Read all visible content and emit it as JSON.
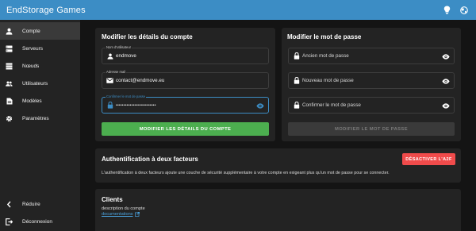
{
  "app": {
    "title": "EndStorage Games"
  },
  "topbar": {
    "icons": [
      "lightbulb-icon",
      "globe-icon"
    ]
  },
  "sidebar": {
    "items": [
      {
        "label": "Compte",
        "icon": "user-icon",
        "active": true
      },
      {
        "label": "Serveurs",
        "icon": "server-icon",
        "active": false
      },
      {
        "label": "Nœuds",
        "icon": "nodes-icon",
        "active": false
      },
      {
        "label": "Utilisateurs",
        "icon": "users-icon",
        "active": false
      },
      {
        "label": "Modèles",
        "icon": "file-icon",
        "active": false
      },
      {
        "label": "Paramètres",
        "icon": "gear-icon",
        "active": false
      }
    ],
    "collapse_label": "Réduire",
    "logout_label": "Déconnexion"
  },
  "account_card": {
    "title": "Modifier les détails du compte",
    "username": {
      "label": "Nom d'utilisateur",
      "value": "endmove"
    },
    "email": {
      "label": "Adresse mail",
      "value": "contact@endmove.eu"
    },
    "password": {
      "label": "Confirmer le mot de passe",
      "value": "••••••••••••••••••••••••••"
    },
    "submit_label": "Modifier les détails du compte"
  },
  "password_card": {
    "title": "Modifier le mot de passe",
    "old_placeholder": "Ancien mot de passe",
    "new_placeholder": "Nouveau mot de passe",
    "confirm_placeholder": "Confirmer le mot de passe",
    "submit_label": "Modifier le mot de passe"
  },
  "twofa_card": {
    "title": "Authentification à deux facteurs",
    "button_label": "Désactiver l'A2F",
    "description": "L'authentification à deux facteurs ajoute une couche de sécurité supplémentaire à votre compte en exigeant plus qu'un mot de passe pour se connecter."
  },
  "clients_card": {
    "title": "Clients",
    "description": "description du compte",
    "link_label": "documentations"
  },
  "colors": {
    "topbar": "#3c8dc5",
    "accent": "#3c8dc5",
    "success": "#4cae4f",
    "danger": "#f04b4b"
  }
}
